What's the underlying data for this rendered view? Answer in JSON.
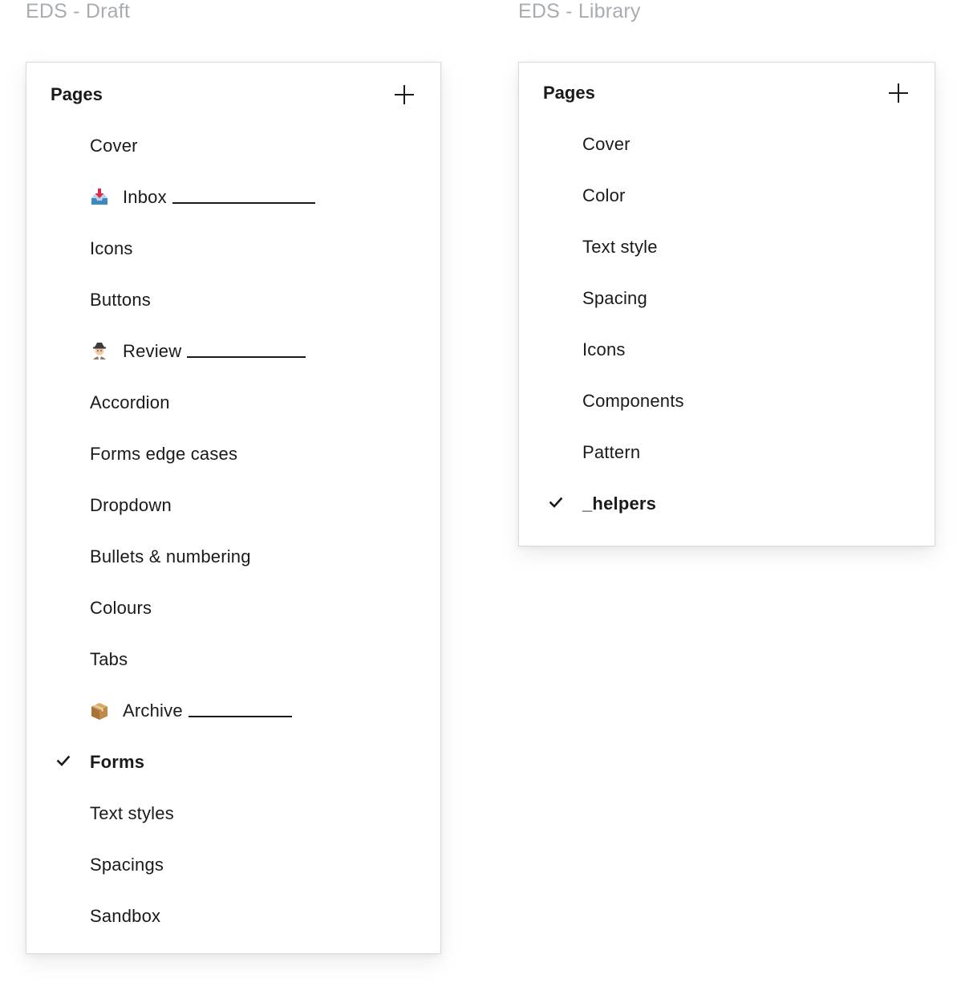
{
  "draft": {
    "file_title": "EDS - Draft",
    "panel_title": "Pages",
    "add_label": "Add page",
    "pages": [
      {
        "label": "Cover"
      },
      {
        "label": "Inbox",
        "emoji": "inbox-tray-icon",
        "divider": true
      },
      {
        "label": "Icons"
      },
      {
        "label": "Buttons"
      },
      {
        "label": "Review",
        "emoji": "detective-icon",
        "divider": true
      },
      {
        "label": "Accordion"
      },
      {
        "label": "Forms edge cases"
      },
      {
        "label": "Dropdown"
      },
      {
        "label": "Bullets & numbering"
      },
      {
        "label": "Colours"
      },
      {
        "label": "Tabs"
      },
      {
        "label": "Archive",
        "emoji": "package-icon",
        "divider": true
      },
      {
        "label": "Forms",
        "current": true
      },
      {
        "label": "Text styles"
      },
      {
        "label": "Spacings"
      },
      {
        "label": "Sandbox"
      }
    ]
  },
  "library": {
    "file_title": "EDS - Library",
    "panel_title": "Pages",
    "add_label": "Add page",
    "pages": [
      {
        "label": "Cover"
      },
      {
        "label": "Color"
      },
      {
        "label": "Text style"
      },
      {
        "label": "Spacing"
      },
      {
        "label": "Icons"
      },
      {
        "label": "Components"
      },
      {
        "label": "Pattern"
      },
      {
        "label": "_helpers",
        "current": true
      }
    ]
  },
  "colors": {
    "file_title": "#a8adb3",
    "text": "#1a1a1a",
    "panel_border": "#d9d9d9"
  }
}
